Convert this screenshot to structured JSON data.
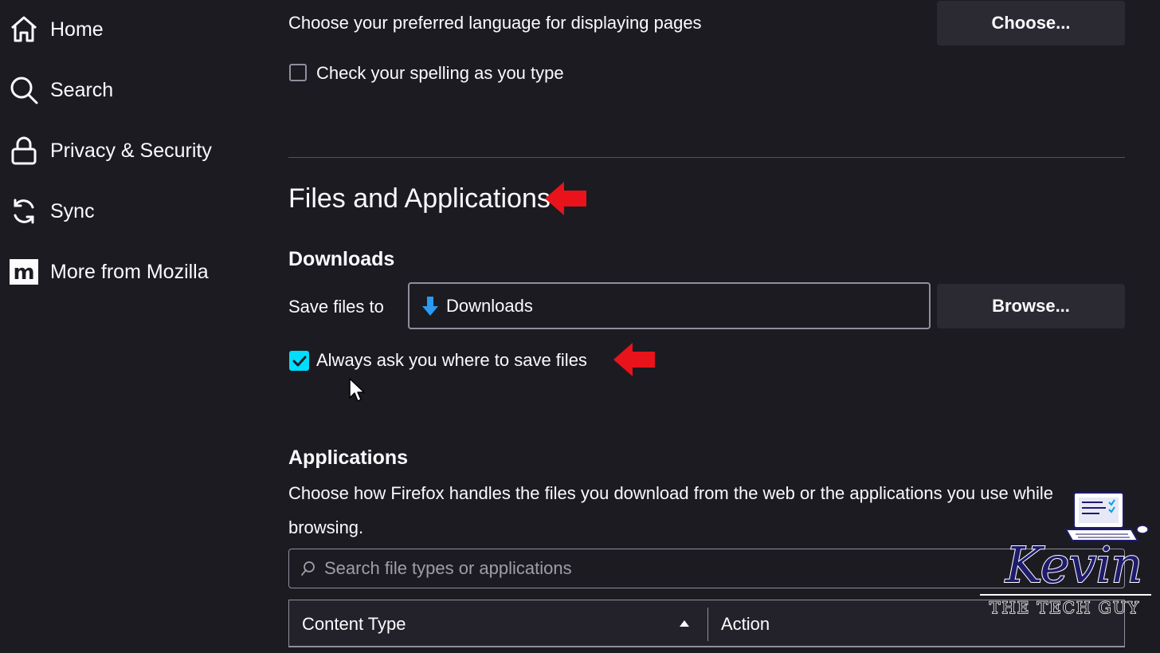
{
  "sidebar": {
    "items": [
      {
        "label": "Home",
        "icon": "home-icon"
      },
      {
        "label": "Search",
        "icon": "search-icon"
      },
      {
        "label": "Privacy & Security",
        "icon": "lock-icon"
      },
      {
        "label": "Sync",
        "icon": "sync-icon"
      },
      {
        "label": "More from Mozilla",
        "icon": "mozilla-icon"
      }
    ]
  },
  "language": {
    "description": "Choose your preferred language for displaying pages",
    "choose_button": "Choose...",
    "spellcheck_label": "Check your spelling as you type",
    "spellcheck_checked": false
  },
  "files_apps": {
    "title": "Files and Applications",
    "downloads": {
      "heading": "Downloads",
      "save_to_label": "Save files to",
      "folder_value": "Downloads",
      "browse_button": "Browse...",
      "always_ask_label": "Always ask you where to save files",
      "always_ask_checked": true
    },
    "applications": {
      "heading": "Applications",
      "description_line1": "Choose how Firefox handles the files you download from the web or the applications you use while",
      "description_line2": "browsing.",
      "search_placeholder": "Search file types or applications",
      "columns": [
        "Content Type",
        "Action"
      ]
    }
  },
  "watermark": {
    "name": "Kevin",
    "tagline": "THE TECH GUY"
  },
  "colors": {
    "background": "#1c1b22",
    "button_bg": "#2b2a33",
    "accent_checkbox": "#00ddff",
    "annotation_arrow": "#e8131b",
    "download_arrow": "#2a9af3"
  }
}
